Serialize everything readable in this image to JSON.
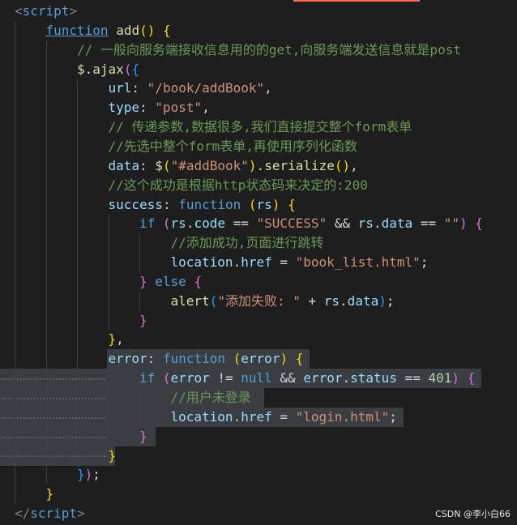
{
  "colors": {
    "background": "#1e1e1e",
    "selection": "#3a3d41",
    "keyword": "#569cd6",
    "string": "#ce9178",
    "comment": "#6a9955",
    "property": "#9cdcfe",
    "function": "#dcdcaa",
    "number": "#b5cea8",
    "bracket_gold": "#ffd700",
    "bracket_magenta": "#da70d6",
    "bracket_blue": "#179fff",
    "tag": "#808080",
    "text": "#d4d4d4"
  },
  "editor": {
    "lines": [
      {
        "indent": 0,
        "tokens": [
          {
            "t": "<",
            "c": "tag"
          },
          {
            "t": "script",
            "c": "keyword"
          },
          {
            "t": ">",
            "c": "tag"
          }
        ]
      },
      {
        "indent": 1,
        "tokens": [
          {
            "t": "function",
            "c": "keyword_ul"
          },
          {
            "t": " ",
            "c": "text"
          },
          {
            "t": "add",
            "c": "function"
          },
          {
            "t": "()",
            "c": "bracket_gold"
          },
          {
            "t": " ",
            "c": "text"
          },
          {
            "t": "{",
            "c": "bracket_gold"
          }
        ]
      },
      {
        "indent": 2,
        "tokens": [
          {
            "t": "// 一般向服务端接收信息用的的get,向服务端发送信息就是post",
            "c": "comment"
          }
        ]
      },
      {
        "indent": 2,
        "tokens": [
          {
            "t": "$",
            "c": "function"
          },
          {
            "t": ".",
            "c": "text"
          },
          {
            "t": "ajax",
            "c": "function"
          },
          {
            "t": "(",
            "c": "bracket_magenta"
          },
          {
            "t": "{",
            "c": "bracket_blue"
          }
        ]
      },
      {
        "indent": 3,
        "tokens": [
          {
            "t": "url",
            "c": "property"
          },
          {
            "t": ": ",
            "c": "text"
          },
          {
            "t": "\"/book/addBook\"",
            "c": "string"
          },
          {
            "t": ",",
            "c": "text"
          }
        ]
      },
      {
        "indent": 3,
        "tokens": [
          {
            "t": "type",
            "c": "property"
          },
          {
            "t": ": ",
            "c": "text"
          },
          {
            "t": "\"post\"",
            "c": "string"
          },
          {
            "t": ",",
            "c": "text"
          }
        ]
      },
      {
        "indent": 3,
        "tokens": [
          {
            "t": "// 传递参数,数据很多,我们直接提交整个form表单",
            "c": "comment"
          }
        ]
      },
      {
        "indent": 3,
        "tokens": [
          {
            "t": "//先选中整个form表单,再使用序列化函数",
            "c": "comment"
          }
        ]
      },
      {
        "indent": 3,
        "tokens": [
          {
            "t": "data",
            "c": "property"
          },
          {
            "t": ": ",
            "c": "text"
          },
          {
            "t": "$",
            "c": "function"
          },
          {
            "t": "(",
            "c": "bracket_gold"
          },
          {
            "t": "\"#addBook\"",
            "c": "string"
          },
          {
            "t": ")",
            "c": "bracket_gold"
          },
          {
            "t": ".",
            "c": "text"
          },
          {
            "t": "serialize",
            "c": "function"
          },
          {
            "t": "()",
            "c": "bracket_gold"
          },
          {
            "t": ",",
            "c": "text"
          }
        ]
      },
      {
        "indent": 3,
        "tokens": [
          {
            "t": "//这个成功是根据http状态码来决定的:200",
            "c": "comment"
          }
        ]
      },
      {
        "indent": 3,
        "tokens": [
          {
            "t": "success",
            "c": "property"
          },
          {
            "t": ": ",
            "c": "text"
          },
          {
            "t": "function",
            "c": "keyword"
          },
          {
            "t": " ",
            "c": "text"
          },
          {
            "t": "(",
            "c": "bracket_gold"
          },
          {
            "t": "rs",
            "c": "property"
          },
          {
            "t": ")",
            "c": "bracket_gold"
          },
          {
            "t": " ",
            "c": "text"
          },
          {
            "t": "{",
            "c": "bracket_gold"
          }
        ]
      },
      {
        "indent": 4,
        "tokens": [
          {
            "t": "if",
            "c": "keyword"
          },
          {
            "t": " ",
            "c": "text"
          },
          {
            "t": "(",
            "c": "bracket_magenta"
          },
          {
            "t": "rs",
            "c": "property"
          },
          {
            "t": ".",
            "c": "text"
          },
          {
            "t": "code",
            "c": "property"
          },
          {
            "t": " == ",
            "c": "text"
          },
          {
            "t": "\"SUCCESS\"",
            "c": "string"
          },
          {
            "t": " && ",
            "c": "text"
          },
          {
            "t": "rs",
            "c": "property"
          },
          {
            "t": ".",
            "c": "text"
          },
          {
            "t": "data",
            "c": "property"
          },
          {
            "t": " == ",
            "c": "text"
          },
          {
            "t": "\"\"",
            "c": "string"
          },
          {
            "t": ")",
            "c": "bracket_magenta"
          },
          {
            "t": " ",
            "c": "text"
          },
          {
            "t": "{",
            "c": "bracket_magenta"
          }
        ]
      },
      {
        "indent": 5,
        "tokens": [
          {
            "t": "//添加成功,页面进行跳转",
            "c": "comment"
          }
        ]
      },
      {
        "indent": 5,
        "tokens": [
          {
            "t": "location",
            "c": "property"
          },
          {
            "t": ".",
            "c": "text"
          },
          {
            "t": "href",
            "c": "property"
          },
          {
            "t": " = ",
            "c": "text"
          },
          {
            "t": "\"book_list.html\"",
            "c": "string"
          },
          {
            "t": ";",
            "c": "text"
          }
        ]
      },
      {
        "indent": 4,
        "tokens": [
          {
            "t": "}",
            "c": "bracket_magenta"
          },
          {
            "t": " ",
            "c": "text"
          },
          {
            "t": "else",
            "c": "keyword"
          },
          {
            "t": " ",
            "c": "text"
          },
          {
            "t": "{",
            "c": "bracket_magenta"
          }
        ]
      },
      {
        "indent": 5,
        "tokens": [
          {
            "t": "alert",
            "c": "function"
          },
          {
            "t": "(",
            "c": "bracket_blue"
          },
          {
            "t": "\"添加失败: \"",
            "c": "string"
          },
          {
            "t": " + ",
            "c": "text"
          },
          {
            "t": "rs",
            "c": "property"
          },
          {
            "t": ".",
            "c": "text"
          },
          {
            "t": "data",
            "c": "property"
          },
          {
            "t": ")",
            "c": "bracket_blue"
          },
          {
            "t": ";",
            "c": "text"
          }
        ]
      },
      {
        "indent": 4,
        "tokens": [
          {
            "t": "}",
            "c": "bracket_magenta"
          }
        ]
      },
      {
        "indent": 3,
        "tokens": [
          {
            "t": "}",
            "c": "bracket_gold"
          },
          {
            "t": ",",
            "c": "text"
          }
        ]
      },
      {
        "indent": 3,
        "tokens": [
          {
            "t": "error",
            "c": "property"
          },
          {
            "t": ": ",
            "c": "text"
          },
          {
            "t": "function",
            "c": "keyword"
          },
          {
            "t": " ",
            "c": "text"
          },
          {
            "t": "(",
            "c": "bracket_gold"
          },
          {
            "t": "error",
            "c": "property"
          },
          {
            "t": ")",
            "c": "bracket_gold"
          },
          {
            "t": " ",
            "c": "text"
          },
          {
            "t": "{",
            "c": "bracket_gold"
          }
        ]
      },
      {
        "indent": 4,
        "tokens": [
          {
            "t": "if",
            "c": "keyword"
          },
          {
            "t": " ",
            "c": "text"
          },
          {
            "t": "(",
            "c": "bracket_magenta"
          },
          {
            "t": "error",
            "c": "property"
          },
          {
            "t": " != ",
            "c": "text"
          },
          {
            "t": "null",
            "c": "keyword"
          },
          {
            "t": " && ",
            "c": "text"
          },
          {
            "t": "error",
            "c": "property"
          },
          {
            "t": ".",
            "c": "text"
          },
          {
            "t": "status",
            "c": "property"
          },
          {
            "t": " == ",
            "c": "text"
          },
          {
            "t": "401",
            "c": "number"
          },
          {
            "t": ")",
            "c": "bracket_magenta"
          },
          {
            "t": " ",
            "c": "text"
          },
          {
            "t": "{",
            "c": "bracket_magenta"
          }
        ]
      },
      {
        "indent": 5,
        "tokens": [
          {
            "t": "//用户未登录",
            "c": "comment"
          }
        ]
      },
      {
        "indent": 5,
        "tokens": [
          {
            "t": "location",
            "c": "property"
          },
          {
            "t": ".",
            "c": "text"
          },
          {
            "t": "href",
            "c": "property"
          },
          {
            "t": " = ",
            "c": "text"
          },
          {
            "t": "\"login.html\"",
            "c": "string"
          },
          {
            "t": ";",
            "c": "text"
          }
        ]
      },
      {
        "indent": 4,
        "tokens": [
          {
            "t": "}",
            "c": "bracket_magenta"
          }
        ]
      },
      {
        "indent": 3,
        "tokens": [
          {
            "t": "}",
            "c": "bracket_gold"
          }
        ]
      },
      {
        "indent": 2,
        "tokens": [
          {
            "t": "}",
            "c": "bracket_blue"
          },
          {
            "t": ")",
            "c": "bracket_magenta"
          },
          {
            "t": ";",
            "c": "text"
          }
        ]
      },
      {
        "indent": 1,
        "tokens": [
          {
            "t": "}",
            "c": "bracket_gold"
          }
        ]
      },
      {
        "indent": 0,
        "tokens": [
          {
            "t": "</",
            "c": "tag"
          },
          {
            "t": "script",
            "c": "keyword"
          },
          {
            "t": ">",
            "c": "tag"
          }
        ]
      }
    ]
  },
  "watermark": "CSDN @李小白66"
}
